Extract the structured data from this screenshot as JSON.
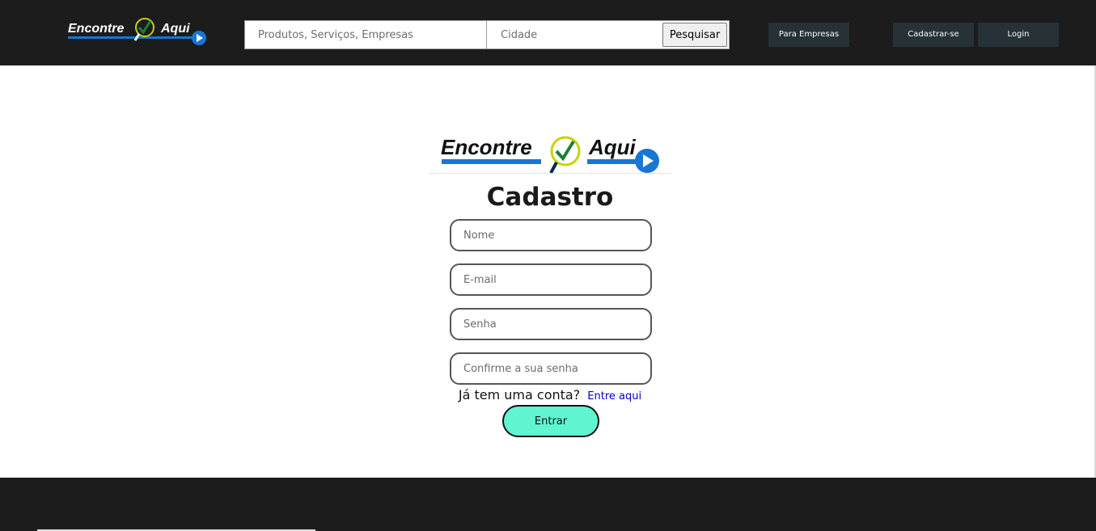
{
  "brand": {
    "word1": "Encontre",
    "word2": "Aqui",
    "blue": "#1976d2",
    "check_green": "#1b7f3b",
    "ring_yellow": "#c6d400"
  },
  "header": {
    "search_placeholder": "Produtos, Serviços, Empresas",
    "city_placeholder": "Cidade",
    "search_button": "Pesquisar",
    "for_business_button": "Para Empresas",
    "signup_button": "Cadastrar-se",
    "login_button": "Login"
  },
  "form": {
    "title": "Cadastro",
    "name_placeholder": "Nome",
    "email_placeholder": "E-mail",
    "password_placeholder": "Senha",
    "confirm_placeholder": "Confirme a sua senha",
    "have_account": "Já tem uma conta?",
    "login_link": "Entre aqui",
    "submit": "Entrar",
    "submit_color": "#5ff5d0"
  },
  "colors": {
    "header_bg": "#1c1c1c",
    "nav_button_bg": "#263238",
    "link": "#0000cc"
  }
}
